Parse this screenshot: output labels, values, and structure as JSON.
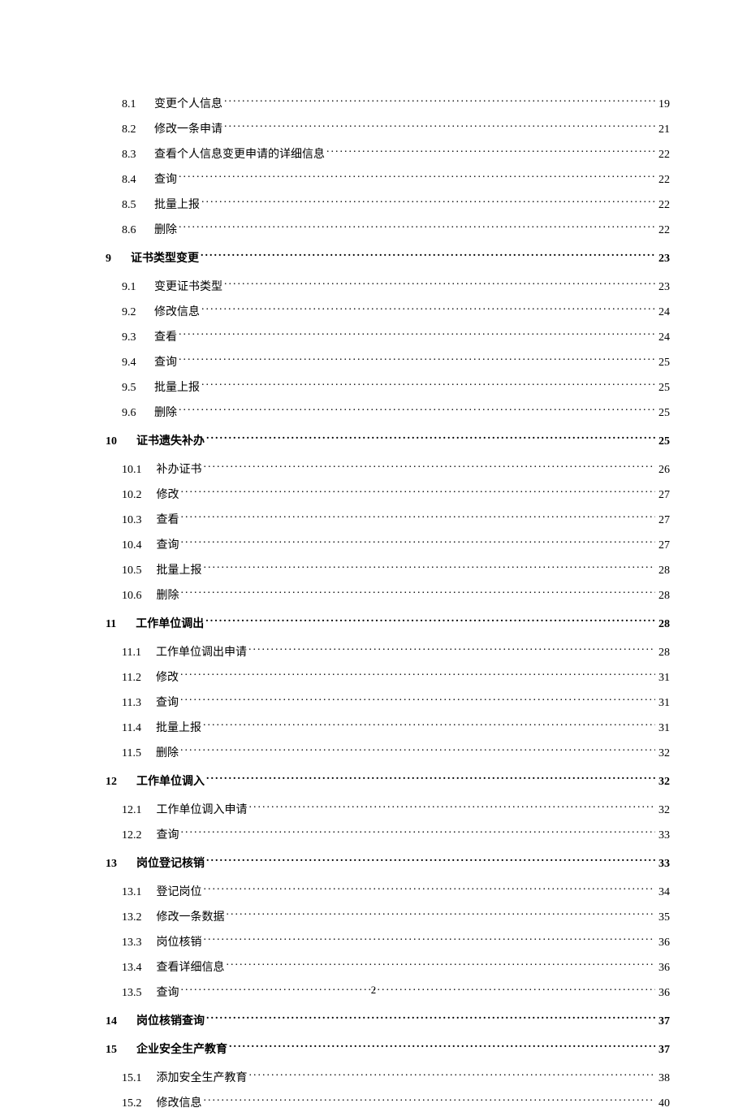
{
  "page_number": "2",
  "toc": [
    {
      "level": 2,
      "num": "8.1",
      "title": "变更个人信息",
      "page": "19"
    },
    {
      "level": 2,
      "num": "8.2",
      "title": "修改一条申请",
      "page": "21"
    },
    {
      "level": 2,
      "num": "8.3",
      "title": "查看个人信息变更申请的详细信息",
      "page": "22"
    },
    {
      "level": 2,
      "num": "8.4",
      "title": "查询",
      "page": "22"
    },
    {
      "level": 2,
      "num": "8.5",
      "title": "批量上报",
      "page": "22"
    },
    {
      "level": 2,
      "num": "8.6",
      "title": "删除",
      "page": "22"
    },
    {
      "level": 1,
      "num": "9",
      "title": "证书类型变更",
      "page": "23"
    },
    {
      "level": 2,
      "num": "9.1",
      "title": "变更证书类型",
      "page": "23"
    },
    {
      "level": 2,
      "num": "9.2",
      "title": "修改信息",
      "page": "24"
    },
    {
      "level": 2,
      "num": "9.3",
      "title": "查看",
      "page": "24"
    },
    {
      "level": 2,
      "num": "9.4",
      "title": "查询",
      "page": "25"
    },
    {
      "level": 2,
      "num": "9.5",
      "title": "批量上报",
      "page": "25"
    },
    {
      "level": 2,
      "num": "9.6",
      "title": "删除",
      "page": "25"
    },
    {
      "level": 1,
      "num": "10",
      "title": "证书遗失补办",
      "page": "25"
    },
    {
      "level": 2,
      "num": "10.1",
      "title": "补办证书",
      "page": "26"
    },
    {
      "level": 2,
      "num": "10.2",
      "title": "修改",
      "page": "27"
    },
    {
      "level": 2,
      "num": "10.3",
      "title": "查看",
      "page": "27"
    },
    {
      "level": 2,
      "num": "10.4",
      "title": "查询",
      "page": "27"
    },
    {
      "level": 2,
      "num": "10.5",
      "title": "批量上报",
      "page": "28"
    },
    {
      "level": 2,
      "num": "10.6",
      "title": "删除",
      "page": "28"
    },
    {
      "level": 1,
      "num": "11",
      "title": "工作单位调出",
      "page": "28"
    },
    {
      "level": 2,
      "num": "11.1",
      "title": "工作单位调出申请",
      "page": "28"
    },
    {
      "level": 2,
      "num": "11.2",
      "title": "修改",
      "page": "31"
    },
    {
      "level": 2,
      "num": "11.3",
      "title": "查询",
      "page": "31"
    },
    {
      "level": 2,
      "num": "11.4",
      "title": "批量上报",
      "page": "31"
    },
    {
      "level": 2,
      "num": "11.5",
      "title": "删除",
      "page": "32"
    },
    {
      "level": 1,
      "num": "12",
      "title": "工作单位调入",
      "page": "32"
    },
    {
      "level": 2,
      "num": "12.1",
      "title": "工作单位调入申请",
      "page": "32"
    },
    {
      "level": 2,
      "num": "12.2",
      "title": "查询",
      "page": "33"
    },
    {
      "level": 1,
      "num": "13",
      "title": "岗位登记核销",
      "page": "33"
    },
    {
      "level": 2,
      "num": "13.1",
      "title": "登记岗位",
      "page": "34"
    },
    {
      "level": 2,
      "num": "13.2",
      "title": "修改一条数据",
      "page": "35"
    },
    {
      "level": 2,
      "num": "13.3",
      "title": "岗位核销",
      "page": "36"
    },
    {
      "level": 2,
      "num": "13.4",
      "title": "查看详细信息",
      "page": "36"
    },
    {
      "level": 2,
      "num": "13.5",
      "title": "查询",
      "page": "36"
    },
    {
      "level": 1,
      "num": "14",
      "title": "岗位核销查询",
      "page": "37"
    },
    {
      "level": 1,
      "num": "15",
      "title": "企业安全生产教育",
      "page": "37"
    },
    {
      "level": 2,
      "num": "15.1",
      "title": "添加安全生产教育",
      "page": "38"
    },
    {
      "level": 2,
      "num": "15.2",
      "title": "修改信息",
      "page": "40"
    }
  ]
}
